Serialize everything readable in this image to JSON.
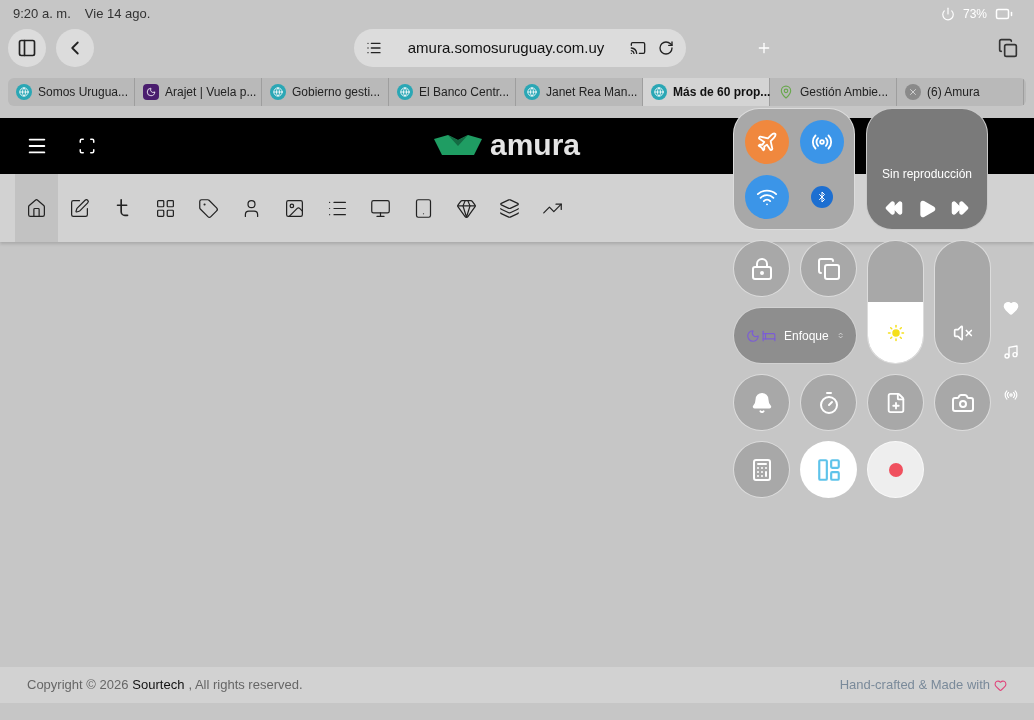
{
  "status_bar": {
    "time": "9:20 a. m.",
    "date": "Vie 14 ago.",
    "battery": "73%"
  },
  "browser": {
    "url": "amura.somosuruguay.com.uy"
  },
  "tabs": [
    {
      "title": "Somos Urugua...",
      "kind": "site",
      "selected": false
    },
    {
      "title": "Arajet | Vuela p...",
      "kind": "arajet",
      "selected": false
    },
    {
      "title": "Gobierno gesti...",
      "kind": "site",
      "selected": false
    },
    {
      "title": "El Banco Centr...",
      "kind": "site",
      "selected": false
    },
    {
      "title": "Janet Rea Man...",
      "kind": "site",
      "selected": false
    },
    {
      "title": "Más de 60 prop...",
      "kind": "site",
      "selected": true
    },
    {
      "title": "Gestión Ambie...",
      "kind": "maps",
      "selected": false
    },
    {
      "title": "(6) Amura",
      "kind": "closable",
      "selected": false
    }
  ],
  "header": {
    "logo": "amura"
  },
  "nav": [
    {
      "kind": "home",
      "selected": true
    },
    {
      "kind": "edit",
      "selected": false
    },
    {
      "kind": "tumblr",
      "selected": false
    },
    {
      "kind": "grid",
      "selected": false
    },
    {
      "kind": "tag",
      "selected": false
    },
    {
      "kind": "user",
      "selected": false
    },
    {
      "kind": "image",
      "selected": false
    },
    {
      "kind": "list",
      "selected": false
    },
    {
      "kind": "monitor",
      "selected": false
    },
    {
      "kind": "tablet",
      "selected": false
    },
    {
      "kind": "gem",
      "selected": false
    },
    {
      "kind": "layers",
      "selected": false
    },
    {
      "kind": "chart",
      "selected": false
    }
  ],
  "footer": {
    "copyright": "Copyright © 2026",
    "company": "Sourtech",
    "rights": ", All rights reserved.",
    "credit": "Hand-crafted & Made with"
  },
  "control_center": {
    "connectivity": [
      {
        "kind": "airplane",
        "on": true
      },
      {
        "kind": "airdrop",
        "on": true
      },
      {
        "kind": "wifi",
        "on": true
      },
      {
        "kind": "bluetooth",
        "on": true
      }
    ],
    "media": {
      "status": "Sin reproducción"
    },
    "focus": {
      "label": "Enfoque"
    },
    "brightness": {
      "level": 0.5
    },
    "volume": {
      "level": 0,
      "muted": true
    },
    "record": {
      "on": false
    }
  }
}
